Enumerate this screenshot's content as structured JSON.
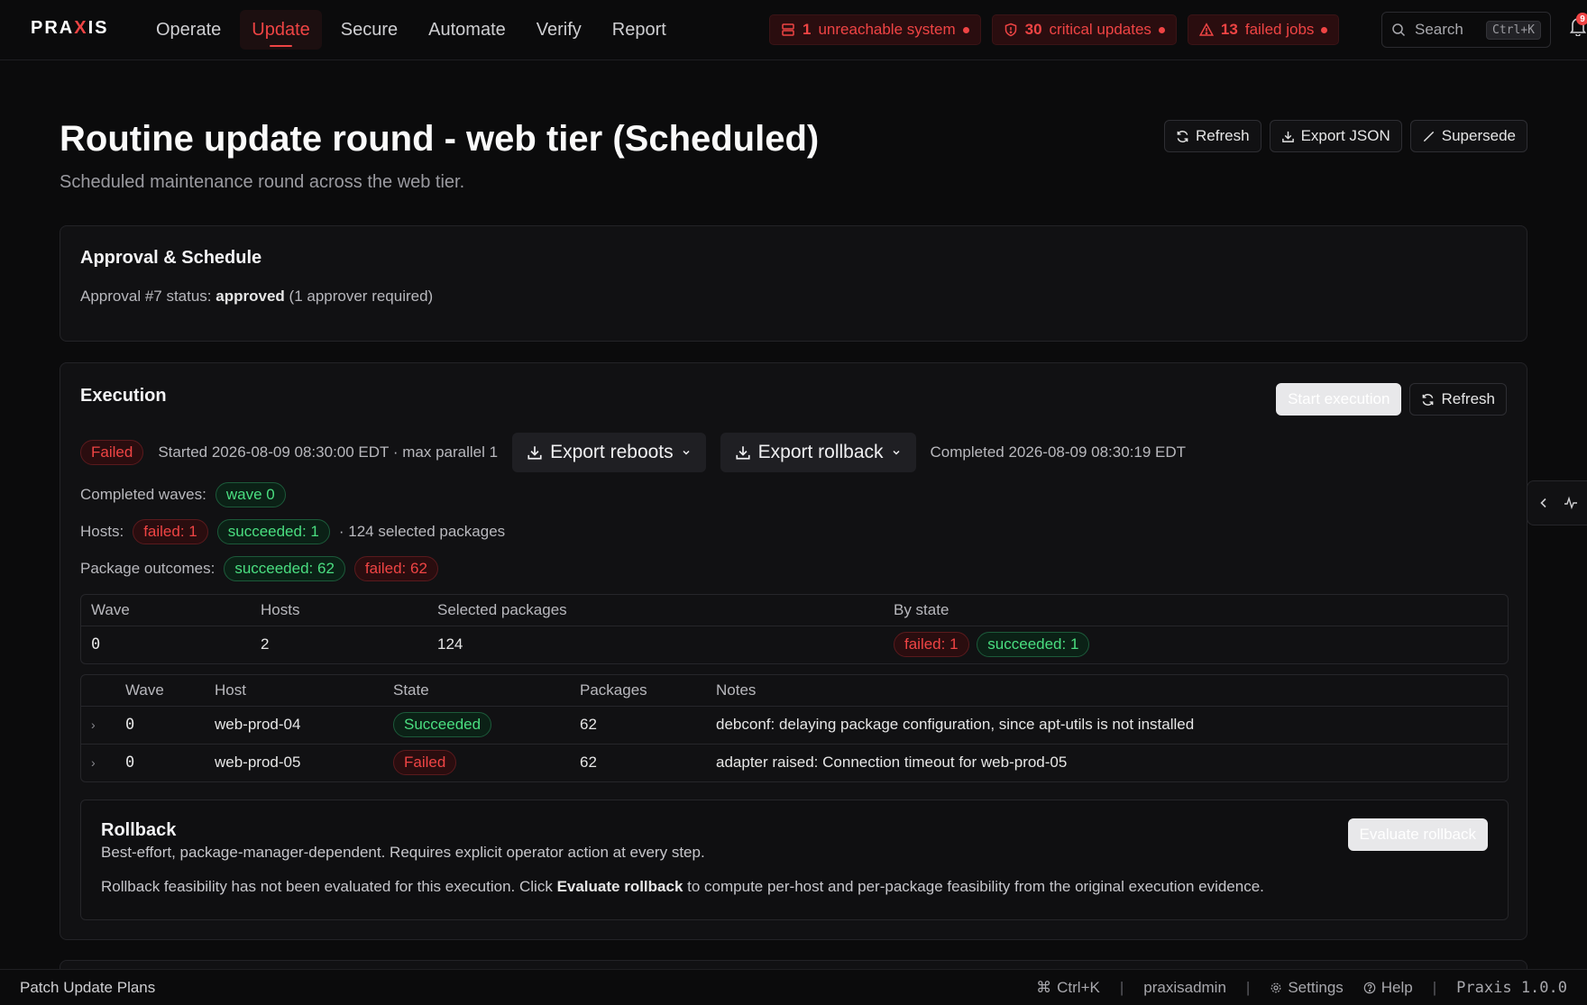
{
  "app": {
    "logo_pre": "PRA",
    "logo_x": "X",
    "logo_post": "IS"
  },
  "nav": {
    "tabs": [
      "Operate",
      "Update",
      "Secure",
      "Automate",
      "Verify",
      "Report"
    ],
    "active": "Update"
  },
  "alerts": [
    {
      "count": "1",
      "label": "unreachable system",
      "icon": "server-icon"
    },
    {
      "count": "30",
      "label": "critical updates",
      "icon": "shield-icon"
    },
    {
      "count": "13",
      "label": "failed jobs",
      "icon": "warning-icon"
    }
  ],
  "search": {
    "label": "Search",
    "shortcut": "Ctrl+K"
  },
  "notifications": {
    "count": "9"
  },
  "header": {
    "title": "Routine update round - web tier (Scheduled)",
    "subtitle": "Scheduled maintenance round across the web tier.",
    "actions": {
      "refresh": "Refresh",
      "export_json": "Export JSON",
      "supersede": "Supersede"
    }
  },
  "approval": {
    "title": "Approval & Schedule",
    "prefix": "Approval #7 status:",
    "status": "approved",
    "suffix": "(1 approver required)"
  },
  "execution": {
    "title": "Execution",
    "start_label": "Start execution",
    "refresh_label": "Refresh",
    "status": "Failed",
    "started": "Started 2026-08-09 08:30:00 EDT · max parallel 1",
    "export_reboots": "Export reboots",
    "export_rollback": "Export rollback",
    "completed": "Completed 2026-08-09 08:30:19 EDT",
    "completed_waves_label": "Completed waves:",
    "completed_waves": [
      "wave 0"
    ],
    "hosts_label": "Hosts:",
    "hosts_failed": "failed: 1",
    "hosts_succeeded": "succeeded: 1",
    "hosts_suffix": "· 124 selected packages",
    "pkg_label": "Package outcomes:",
    "pkg_succeeded": "succeeded: 62",
    "pkg_failed": "failed: 62",
    "wave_table": {
      "headers": [
        "Wave",
        "Hosts",
        "Selected packages",
        "By state"
      ],
      "rows": [
        {
          "wave": "0",
          "hosts": "2",
          "packages": "124",
          "failed": "failed: 1",
          "succeeded": "succeeded: 1"
        }
      ]
    },
    "host_table": {
      "headers": [
        "Wave",
        "Host",
        "State",
        "Packages",
        "Notes"
      ],
      "rows": [
        {
          "wave": "0",
          "host": "web-prod-04",
          "state": "Succeeded",
          "state_kind": "green",
          "packages": "62",
          "notes": "debconf: delaying package configuration, since apt-utils is not installed"
        },
        {
          "wave": "0",
          "host": "web-prod-05",
          "state": "Failed",
          "state_kind": "red",
          "packages": "62",
          "notes": "adapter raised: Connection timeout for web-prod-05"
        }
      ]
    },
    "rollback": {
      "title": "Rollback",
      "desc": "Best-effort, package-manager-dependent. Requires explicit operator action at every step.",
      "note_pre": "Rollback feasibility has not been evaluated for this execution. Click",
      "note_bold": "Evaluate rollback",
      "note_post": "to compute per-host and per-package feasibility from the original execution evidence.",
      "button": "Evaluate rollback"
    }
  },
  "footer": {
    "left": "Patch Update Plans",
    "shortcut": "Ctrl+K",
    "user": "praxisadmin",
    "settings": "Settings",
    "help": "Help",
    "version": "Praxis 1.0.0"
  }
}
